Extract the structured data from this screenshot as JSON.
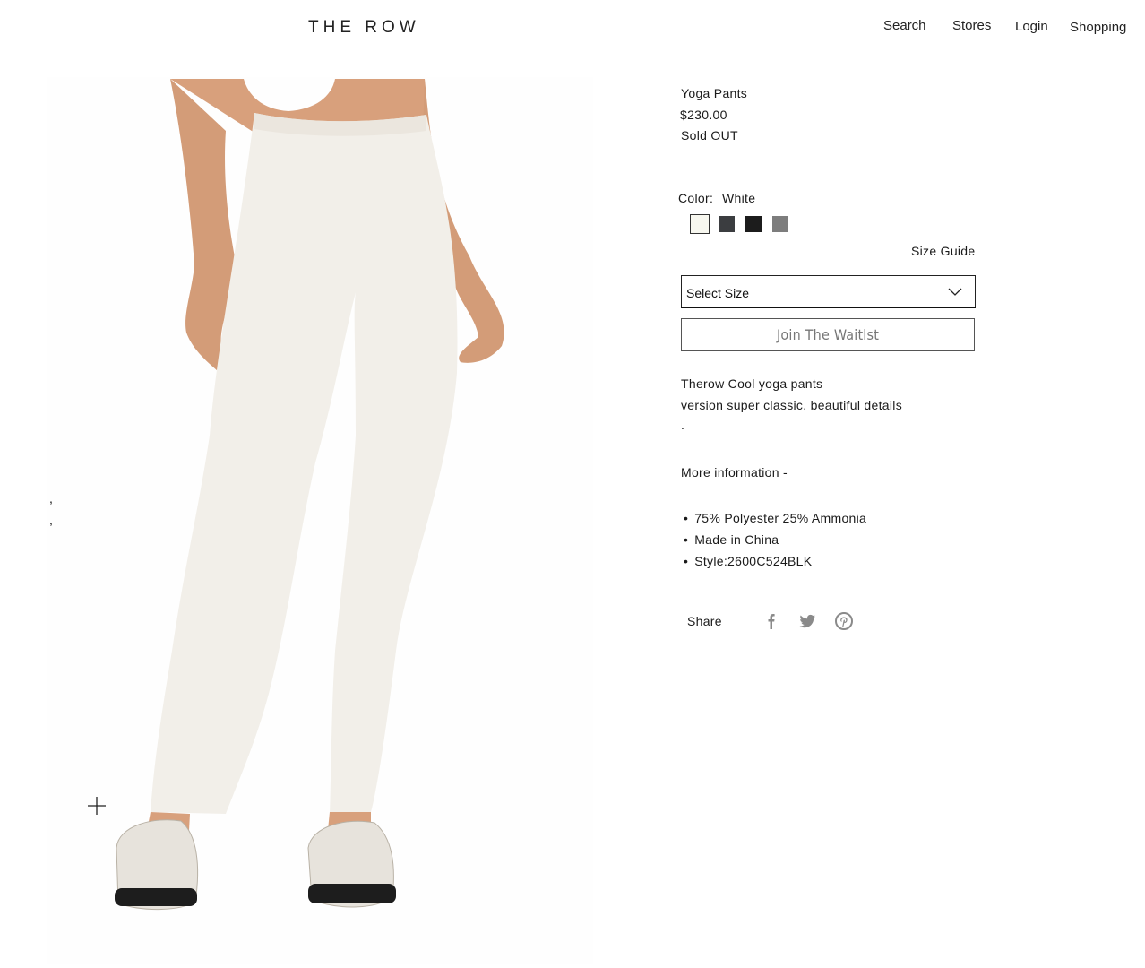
{
  "header": {
    "logo": "THE ROW",
    "nav": [
      "Search",
      "Stores",
      "Login",
      "Shopping"
    ]
  },
  "gallery": {
    "dots": [
      ",",
      ","
    ]
  },
  "product": {
    "name": "Yoga Pants",
    "price": "$230.00",
    "status": "Sold OUT",
    "color_label": "Color:",
    "color_value": "White",
    "swatches": [
      "#f7f7ef",
      "#3b3d40",
      "#1c1c1c",
      "#7d7d7d"
    ],
    "size_guide": "Size Guide",
    "size_select": "Select Size",
    "waitlist_button": "Join  The Waitlst",
    "description": [
      "Therow Cool yoga pants",
      "version super classic, beautiful details",
      "."
    ],
    "more_info": "More information -",
    "details": [
      "75% Polyester 25% Ammonia",
      "Made in China",
      "Style:2600C524BLK"
    ],
    "share_label": "Share",
    "share_icons": [
      "facebook-icon",
      "twitter-icon",
      "pinterest-icon"
    ]
  }
}
